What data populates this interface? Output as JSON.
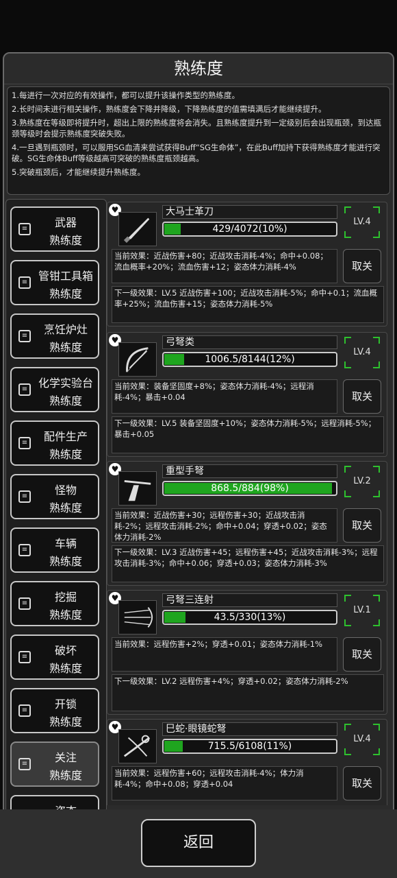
{
  "title": "熟练度",
  "info": [
    "1.每进行一次对应的有效操作，都可以提升该操作类型的熟练度。",
    "2.长时间未进行相关操作，熟练度会下降并降级，下降熟练度的值需填满后才能继续提升。",
    "3.熟练度在等级即将提升时，超出上限的熟练度将会消失。且熟练度提升到一定级别后会出现瓶颈，到达瓶颈等级时会提示熟练度突破失败。",
    "4.一旦遇到瓶颈时，可以服用SG血清来尝试获得Buff“SG生命体”，在此Buff加持下获得熟练度才能进行突破。SG生命体Buff等级越高可突破的熟练度瓶颈越高。",
    "5.突破瓶颈后，才能继续提升熟练度。"
  ],
  "sidebar": [
    {
      "l1": "武器",
      "l2": "熟练度"
    },
    {
      "l1": "管钳工具箱",
      "l2": "熟练度"
    },
    {
      "l1": "烹饪炉灶",
      "l2": "熟练度"
    },
    {
      "l1": "化学实验台",
      "l2": "熟练度"
    },
    {
      "l1": "配件生产",
      "l2": "熟练度"
    },
    {
      "l1": "怪物",
      "l2": "熟练度"
    },
    {
      "l1": "车辆",
      "l2": "熟练度"
    },
    {
      "l1": "挖掘",
      "l2": "熟练度"
    },
    {
      "l1": "破坏",
      "l2": "熟练度"
    },
    {
      "l1": "开锁",
      "l2": "熟练度"
    },
    {
      "l1": "关注",
      "l2": "熟练度"
    },
    {
      "l1": "姿态",
      "l2": ""
    }
  ],
  "cards": [
    {
      "name": "大马士革刀",
      "progress": "429/4072(10%)",
      "fill": 0.105,
      "level": "LV.4",
      "current": "当前效果：近战伤害+80；近战攻击消耗-4%；命中+0.08；流血概率+20%；流血伤害+12；姿态体力消耗-4%",
      "toggle": "取关",
      "next": "下一级效果：LV.5 近战伤害+100；近战攻击消耗-5%；命中+0.1；流血概率+25%；流血伤害+15；姿态体力消耗-5%"
    },
    {
      "name": "弓弩类",
      "progress": "1006.5/8144(12%)",
      "fill": 0.124,
      "level": "LV.4",
      "current": "当前效果：装备坚固度+8%；姿态体力消耗-4%；远程消耗-4%；暴击+0.04",
      "toggle": "取关",
      "next": "下一级效果：LV.5 装备坚固度+10%；姿态体力消耗-5%；远程消耗-5%；暴击+0.05"
    },
    {
      "name": "重型手弩",
      "progress": "868.5/884(98%)",
      "fill": 0.982,
      "level": "LV.2",
      "current": "当前效果：近战伤害+30；远程伤害+30；近战攻击消耗-2%；远程攻击消耗-2%；命中+0.04；穿透+0.02；姿态体力消耗-2%",
      "toggle": "取关",
      "next": "下一级效果：LV.3 近战伤害+45；远程伤害+45；近战攻击消耗-3%；远程攻击消耗-3%；命中+0.06；穿透+0.03；姿态体力消耗-3%"
    },
    {
      "name": "弓弩三连射",
      "progress": "43.5/330(13%)",
      "fill": 0.132,
      "level": "LV.1",
      "current": "当前效果：远程伤害+2%；穿透+0.01；姿态体力消耗-1%",
      "toggle": "取关",
      "next": "下一级效果：LV.2 远程伤害+4%；穿透+0.02；姿态体力消耗-2%"
    },
    {
      "name": "巳蛇·眼镜蛇弩",
      "progress": "715.5/6108(11%)",
      "fill": 0.117,
      "level": "LV.4",
      "current": "当前效果：远程伤害+60；远程攻击消耗-4%；体力消耗-4%；命中+0.08；穿透+0.04",
      "toggle": "取关",
      "next": ""
    }
  ],
  "back_label": "返回",
  "colors": {
    "progress": "#1fa51f",
    "level_frame": "#2ec12e"
  }
}
